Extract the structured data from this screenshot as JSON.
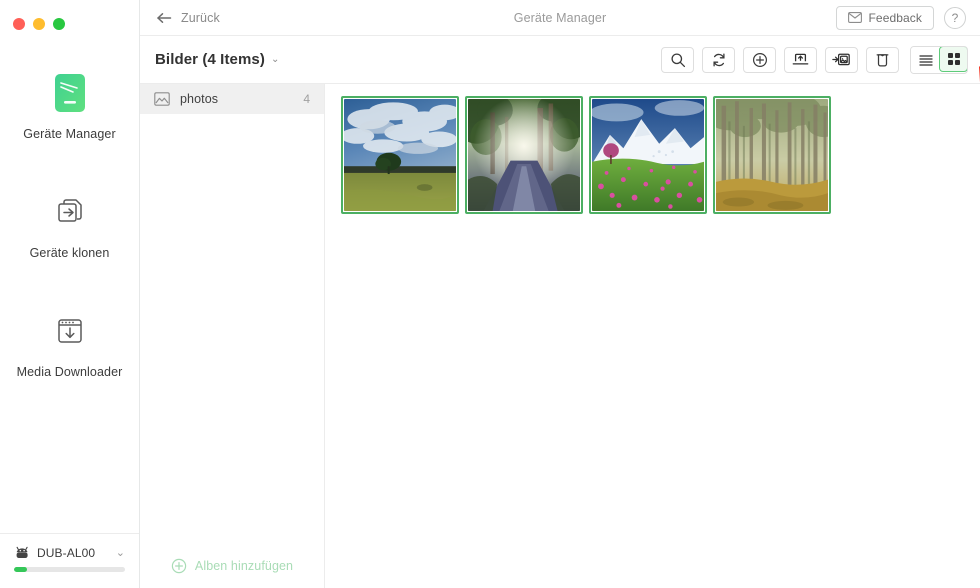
{
  "window": {
    "title": "Geräte Manager",
    "back_label": "Zurück",
    "feedback_label": "Feedback",
    "help_label": "?",
    "traffic_lights": [
      "close",
      "minimize",
      "zoom"
    ]
  },
  "sidebar": {
    "items": [
      {
        "label": "Geräte Manager",
        "icon": "device-manager-icon",
        "active": true
      },
      {
        "label": "Geräte klonen",
        "icon": "device-clone-icon",
        "active": false
      },
      {
        "label": "Media Downloader",
        "icon": "media-downloader-icon",
        "active": false
      }
    ],
    "device": {
      "name": "DUB-AL00",
      "icon": "android-robot-icon",
      "chevron": "⌄",
      "battery_percent": 12
    }
  },
  "toolbar": {
    "breadcrumb_label": "Bilder (4 Items)",
    "breadcrumb_chevron": "⌄",
    "actions": [
      {
        "name": "search-button",
        "icon": "search-icon"
      },
      {
        "name": "refresh-button",
        "icon": "refresh-icon"
      },
      {
        "name": "add-button",
        "icon": "plus-circle-icon"
      },
      {
        "name": "import-button",
        "icon": "import-to-device-icon"
      },
      {
        "name": "export-button",
        "icon": "export-photo-icon"
      },
      {
        "name": "delete-button",
        "icon": "trash-icon"
      }
    ],
    "view_modes": [
      {
        "name": "list-view-button",
        "icon": "list-icon",
        "active": false
      },
      {
        "name": "grid-view-button",
        "icon": "grid-icon",
        "active": true
      }
    ]
  },
  "albums": {
    "items": [
      {
        "label": "photos",
        "count": "4",
        "icon": "image-icon",
        "selected": true
      }
    ],
    "add_label": "Alben hinzufügen",
    "add_icon": "plus-circle-icon"
  },
  "photos": [
    {
      "name": "tree-in-field-with-clouds",
      "selected": true
    },
    {
      "name": "sunlit-forest-road",
      "selected": true
    },
    {
      "name": "snowy-mountain-with-pink-flowers",
      "selected": true
    },
    {
      "name": "misty-birch-forest",
      "selected": true
    }
  ],
  "annotation": {
    "arrow": "red-arrow-pointing-to-export-button",
    "color": "#f22613"
  },
  "colors": {
    "accent_green": "#4caf63",
    "selection_bg": "#f0f0f0",
    "arrow_red": "#f22613",
    "battery_green": "#35c759"
  }
}
